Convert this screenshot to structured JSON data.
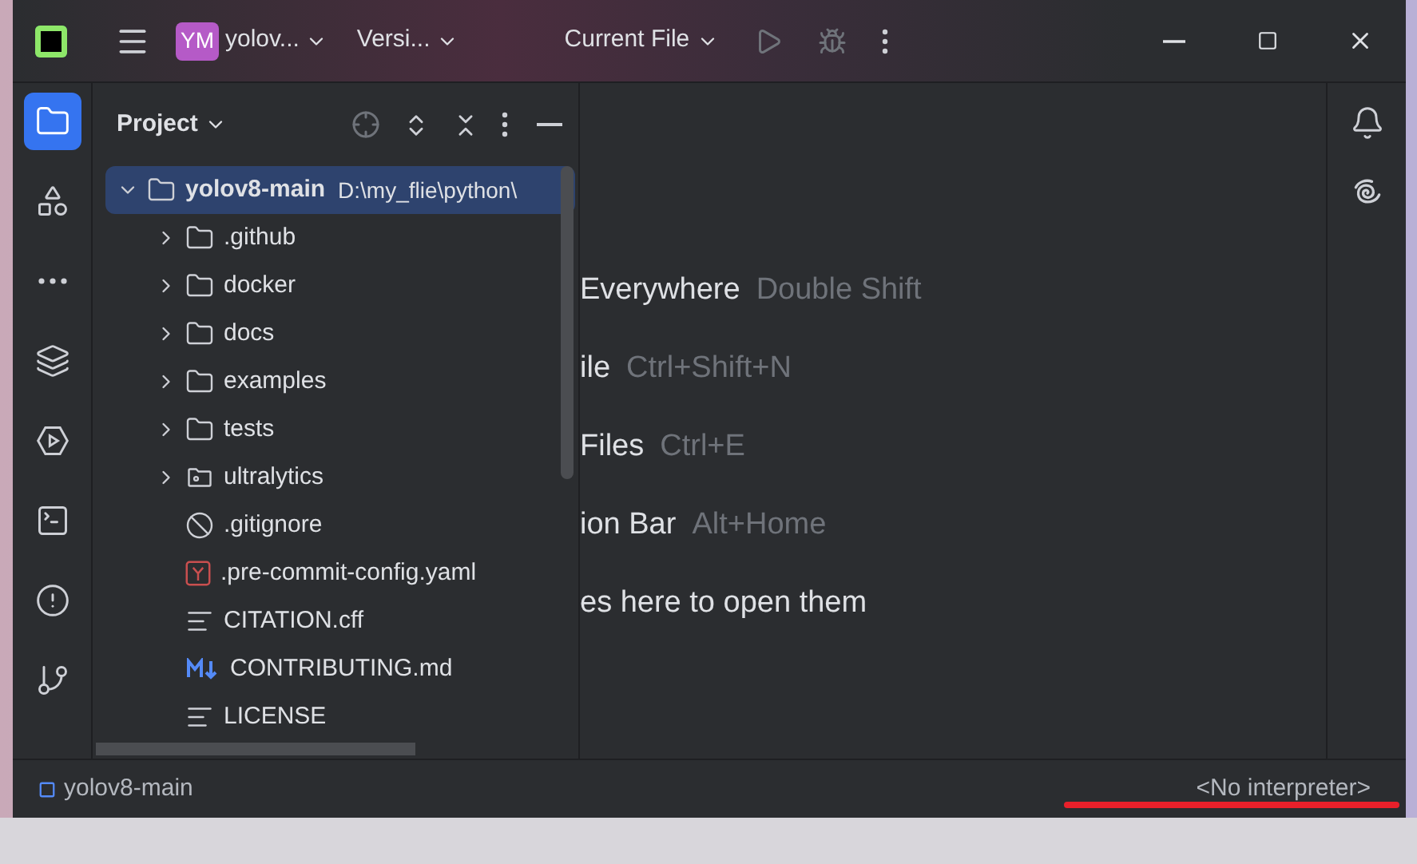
{
  "title_bar": {
    "project_initials": "YM",
    "project_name": "yolov...",
    "vcs": "Versi...",
    "run_config": "Current File"
  },
  "tool_strip": [
    {
      "kind": "project",
      "selected": true
    },
    {
      "kind": "structure",
      "selected": false
    },
    {
      "kind": "more",
      "selected": false
    },
    {
      "kind": "layers",
      "selected": false
    },
    {
      "kind": "services",
      "selected": false
    },
    {
      "kind": "terminal",
      "selected": false
    },
    {
      "kind": "problems",
      "selected": false
    },
    {
      "kind": "git",
      "selected": false
    }
  ],
  "project_panel": {
    "title": "Project",
    "tree": [
      {
        "name": "yolov8-main",
        "path": "D:\\my_flie\\python\\",
        "kind": "folder",
        "expanded": true,
        "selected": true,
        "children": [
          {
            "name": ".github",
            "kind": "folder",
            "expanded": false,
            "selected": false
          },
          {
            "name": "docker",
            "kind": "folder",
            "expanded": false,
            "selected": false
          },
          {
            "name": "docs",
            "kind": "folder",
            "expanded": false,
            "selected": false
          },
          {
            "name": "examples",
            "kind": "folder",
            "expanded": false,
            "selected": false
          },
          {
            "name": "tests",
            "kind": "folder",
            "expanded": false,
            "selected": false
          },
          {
            "name": "ultralytics",
            "kind": "package",
            "expanded": false,
            "selected": false
          },
          {
            "name": ".gitignore",
            "kind": "ignore",
            "selected": false
          },
          {
            "name": ".pre-commit-config.yaml",
            "kind": "yaml",
            "selected": false
          },
          {
            "name": "CITATION.cff",
            "kind": "text",
            "selected": false
          },
          {
            "name": "CONTRIBUTING.md",
            "kind": "markdown",
            "selected": false
          },
          {
            "name": "LICENSE",
            "kind": "text",
            "selected": false
          }
        ]
      }
    ]
  },
  "editor_hints": [
    {
      "action": "Everywhere",
      "shortcut": "Double Shift"
    },
    {
      "action": "ile",
      "shortcut": "Ctrl+Shift+N"
    },
    {
      "action": "Files",
      "shortcut": "Ctrl+E"
    },
    {
      "action": "ion Bar",
      "shortcut": "Alt+Home"
    },
    {
      "action": "es here to open them"
    }
  ],
  "status_bar": {
    "project": "yolov8-main",
    "interpreter": "<No interpreter>"
  }
}
